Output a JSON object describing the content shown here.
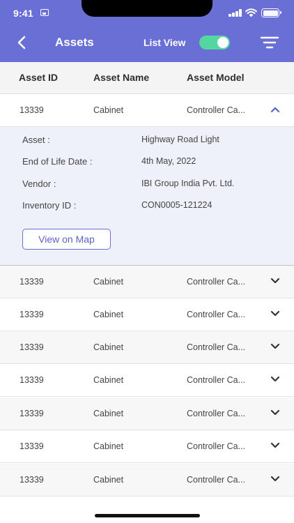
{
  "status_bar": {
    "time": "9:41"
  },
  "header": {
    "title": "Assets",
    "list_view_label": "List View",
    "list_view_on": true
  },
  "columns": [
    "Asset ID",
    "Asset Name",
    "Asset Model"
  ],
  "expanded_row": {
    "asset_id": "13339",
    "asset_name": "Cabinet",
    "asset_model": "Controller Ca...",
    "details": [
      {
        "label": "Asset :",
        "value": "Highway Road Light"
      },
      {
        "label": "End of Life Date :",
        "value": "4th May, 2022"
      },
      {
        "label": "Vendor :",
        "value": "IBI Group India Pvt. Ltd."
      },
      {
        "label": "Inventory ID :",
        "value": "CON0005-121224"
      }
    ],
    "map_button": "View on Map"
  },
  "rows": [
    {
      "asset_id": "13339",
      "asset_name": "Cabinet",
      "asset_model": "Controller Ca..."
    },
    {
      "asset_id": "13339",
      "asset_name": "Cabinet",
      "asset_model": "Controller Ca..."
    },
    {
      "asset_id": "13339",
      "asset_name": "Cabinet",
      "asset_model": "Controller Ca..."
    },
    {
      "asset_id": "13339",
      "asset_name": "Cabinet",
      "asset_model": "Controller Ca..."
    },
    {
      "asset_id": "13339",
      "asset_name": "Cabinet",
      "asset_model": "Controller Ca..."
    },
    {
      "asset_id": "13339",
      "asset_name": "Cabinet",
      "asset_model": "Controller Ca..."
    },
    {
      "asset_id": "13339",
      "asset_name": "Cabinet",
      "asset_model": "Controller Ca..."
    }
  ],
  "colors": {
    "header_bg": "#6a6fd6",
    "toggle_on": "#55d6a0",
    "accent": "#5d62c7",
    "expanded_bg": "#eef0fa"
  }
}
